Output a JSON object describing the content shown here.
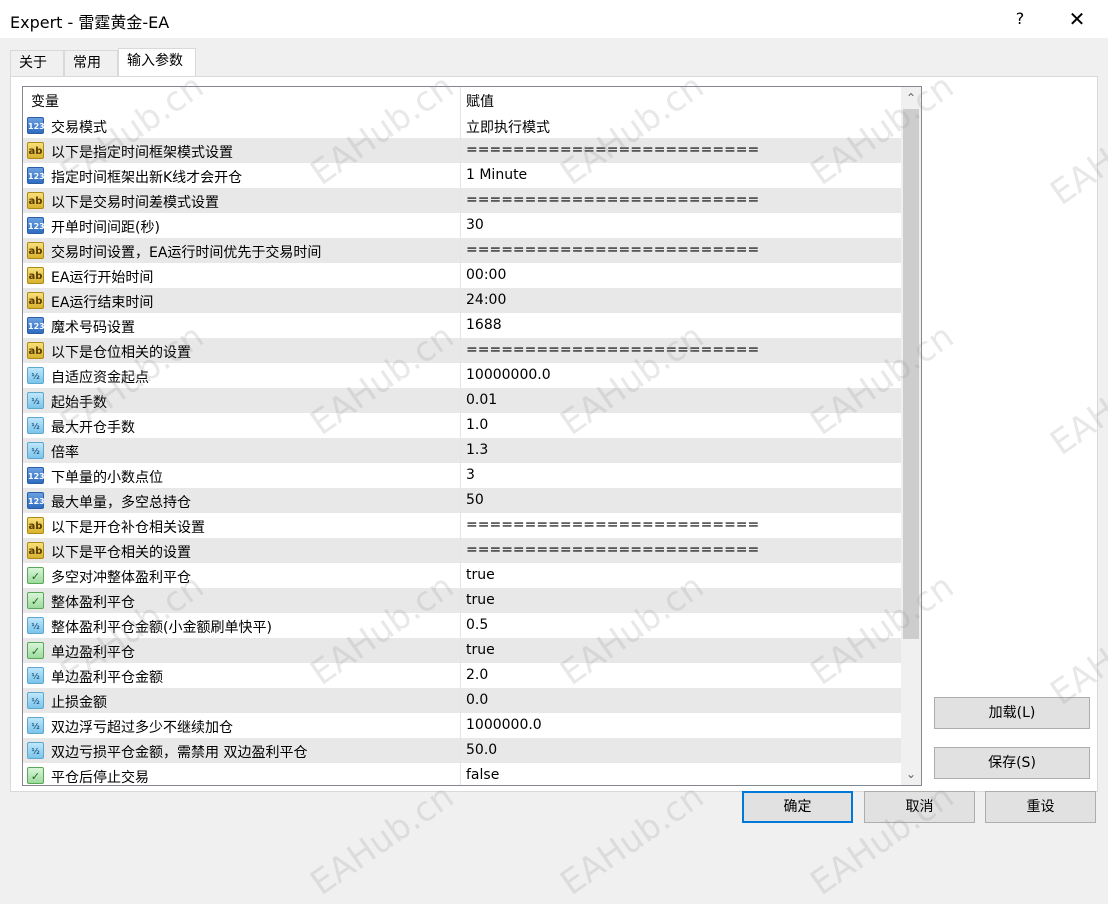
{
  "window": {
    "title": "Expert - 雷霆黄金-EA",
    "help_label": "?",
    "close_label": "✕"
  },
  "tabs": [
    {
      "label": "关于",
      "active": false
    },
    {
      "label": "常用",
      "active": false
    },
    {
      "label": "输入参数",
      "active": true
    }
  ],
  "grid": {
    "col_variable": "变量",
    "col_value": "赋值",
    "rows": [
      {
        "type": "int",
        "icon": "123",
        "name": "交易模式",
        "value": "立即执行模式"
      },
      {
        "type": "str",
        "icon": "ab",
        "name": "以下是指定时间框架模式设置",
        "value": "========================="
      },
      {
        "type": "int",
        "icon": "123",
        "name": "指定时间框架出新K线才会开仓",
        "value": "1 Minute"
      },
      {
        "type": "str",
        "icon": "ab",
        "name": "以下是交易时间差模式设置",
        "value": "========================="
      },
      {
        "type": "int",
        "icon": "123",
        "name": "开单时间间距(秒)",
        "value": "30"
      },
      {
        "type": "str",
        "icon": "ab",
        "name": "交易时间设置，EA运行时间优先于交易时间",
        "value": "========================="
      },
      {
        "type": "str",
        "icon": "ab",
        "name": "EA运行开始时间",
        "value": "00:00"
      },
      {
        "type": "str",
        "icon": "ab",
        "name": "EA运行结束时间",
        "value": "24:00"
      },
      {
        "type": "int",
        "icon": "123",
        "name": "魔术号码设置",
        "value": "1688"
      },
      {
        "type": "str",
        "icon": "ab",
        "name": "以下是仓位相关的设置",
        "value": "========================="
      },
      {
        "type": "dbl",
        "icon": "½",
        "name": "自适应资金起点",
        "value": "10000000.0"
      },
      {
        "type": "dbl",
        "icon": "½",
        "name": "起始手数",
        "value": "0.01"
      },
      {
        "type": "dbl",
        "icon": "½",
        "name": "最大开仓手数",
        "value": "1.0"
      },
      {
        "type": "dbl",
        "icon": "½",
        "name": "倍率",
        "value": "1.3"
      },
      {
        "type": "int",
        "icon": "123",
        "name": "下单量的小数点位",
        "value": "3"
      },
      {
        "type": "int",
        "icon": "123",
        "name": "最大单量，多空总持仓",
        "value": "50"
      },
      {
        "type": "str",
        "icon": "ab",
        "name": "以下是开仓补仓相关设置",
        "value": "========================="
      },
      {
        "type": "str",
        "icon": "ab",
        "name": "以下是平仓相关的设置",
        "value": "========================="
      },
      {
        "type": "bool",
        "icon": "✓",
        "name": "多空对冲整体盈利平仓",
        "value": "true"
      },
      {
        "type": "bool",
        "icon": "✓",
        "name": "整体盈利平仓",
        "value": "true"
      },
      {
        "type": "dbl",
        "icon": "½",
        "name": "整体盈利平仓金额(小金额刷单快平)",
        "value": "0.5"
      },
      {
        "type": "bool",
        "icon": "✓",
        "name": "单边盈利平仓",
        "value": "true"
      },
      {
        "type": "dbl",
        "icon": "½",
        "name": "单边盈利平仓金额",
        "value": "2.0"
      },
      {
        "type": "dbl",
        "icon": "½",
        "name": "止损金额",
        "value": "0.0"
      },
      {
        "type": "dbl",
        "icon": "½",
        "name": "双边浮亏超过多少不继续加仓",
        "value": "1000000.0"
      },
      {
        "type": "dbl",
        "icon": "½",
        "name": "双边亏损平仓金额，需禁用 双边盈利平仓",
        "value": "50.0"
      },
      {
        "type": "bool",
        "icon": "✓",
        "name": "平仓后停止交易",
        "value": "false"
      }
    ]
  },
  "side_buttons": {
    "load_label": "加载(L)",
    "save_label": "保存(S)"
  },
  "footer_buttons": {
    "ok_label": "确定",
    "cancel_label": "取消",
    "reset_label": "重设"
  },
  "watermark_text": "EAHub.cn"
}
